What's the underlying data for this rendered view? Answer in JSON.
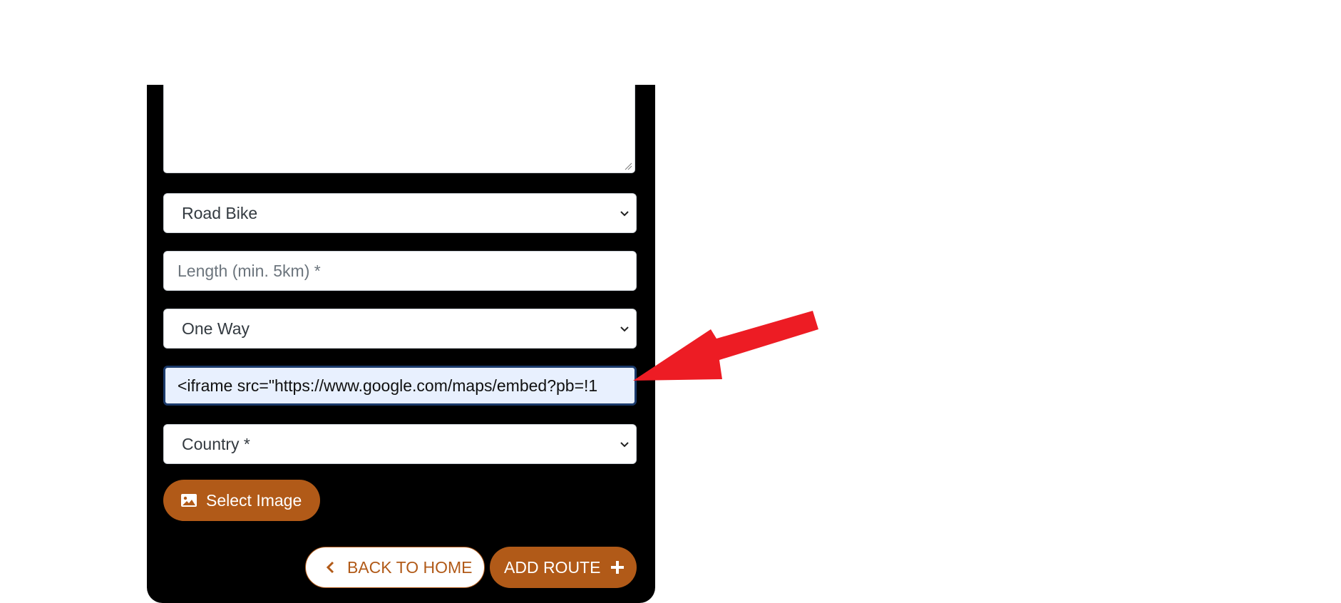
{
  "form": {
    "bike_type": {
      "selected": "Road Bike"
    },
    "length": {
      "placeholder": "Length (min. 5km) *"
    },
    "route_type": {
      "selected": "One Way"
    },
    "map_embed": {
      "value": "<iframe src=\"https://www.google.com/maps/embed?pb=!1"
    },
    "country": {
      "selected": "Country *"
    },
    "select_image_label": "Select Image",
    "back_label": "BACK TO HOME",
    "add_label": "ADD ROUTE"
  },
  "icons": {
    "image": "image-icon",
    "chevron": "chevron-down-icon",
    "back": "chevron-left-icon",
    "plus": "plus-icon",
    "annotation": "red-arrow"
  },
  "colors": {
    "panel": "#000000",
    "accent": "#b15a18",
    "focus_border": "#1b3a6b",
    "autofill_bg": "#e8f0fe",
    "annotation_arrow": "#ed1c24"
  }
}
